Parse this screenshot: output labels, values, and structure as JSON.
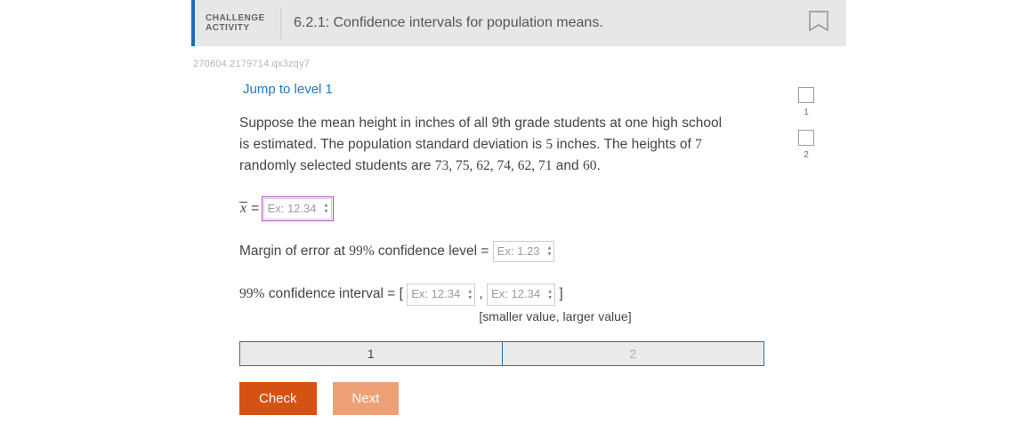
{
  "header": {
    "label_line1": "CHALLENGE",
    "label_line2": "ACTIVITY",
    "title": "6.2.1: Confidence intervals for population means."
  },
  "meta_id": "270604.2179714.qx3zqy7",
  "jump_text": "Jump to level 1",
  "prompt": {
    "p1a": "Suppose the mean height in inches of all 9th grade students at one high school is estimated. The population standard deviation is ",
    "std_dev": "5",
    "p1b": " inches. The heights of ",
    "sample_n": "7",
    "p1c": " randomly selected students are ",
    "values": "73, 75, 62, 74, 62, 71",
    "p1d": " and ",
    "last_value": "60",
    "p1e": "."
  },
  "rows": {
    "xbar_symbol": "x",
    "equals": " = ",
    "mean_placeholder": "Ex: 12.34",
    "moe_label_a": "Margin of error at ",
    "ci_pct": "99%",
    "moe_label_b": " confidence level = ",
    "moe_placeholder": "Ex: 1.23",
    "ci_label": " confidence interval = [ ",
    "ci_low_placeholder": "Ex: 12.34",
    "comma": " , ",
    "ci_high_placeholder": "Ex: 12.34",
    "close": " ]",
    "hint": "[smaller value, larger value]"
  },
  "progress": {
    "step1": "1",
    "step2": "2"
  },
  "buttons": {
    "check": "Check",
    "next": "Next"
  },
  "side": {
    "lv1": "1",
    "lv2": "2"
  }
}
